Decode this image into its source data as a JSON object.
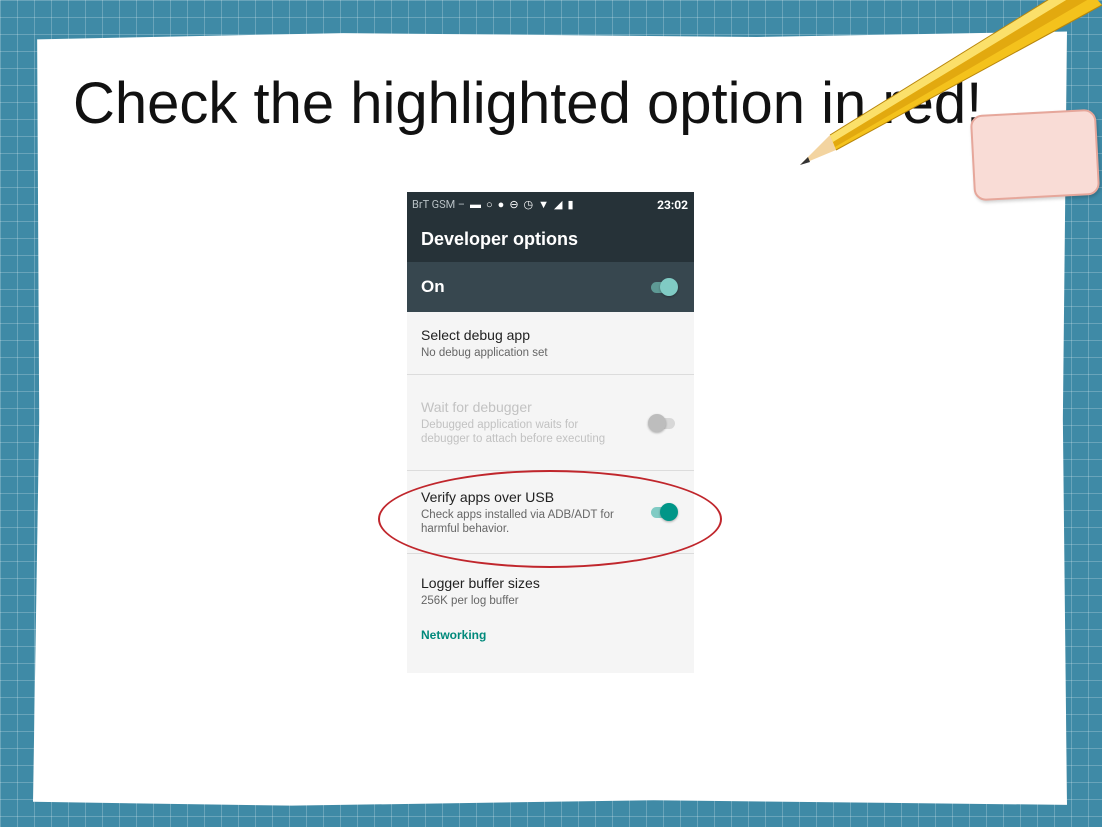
{
  "slide": {
    "title": "Check the highlighted option in red!"
  },
  "colors": {
    "highlight_ellipse": "#c0262c",
    "accent_teal": "#009688",
    "toolbar": "#263238",
    "master_switch_bar": "#37474f",
    "section_header": "#00897b",
    "background_grid": "#3f8aa6"
  },
  "status_bar": {
    "carrier": "BrT GSM — C",
    "icons": [
      "message-icon",
      "search-icon",
      "android-icon",
      "do-not-disturb-icon",
      "alarm-icon",
      "wifi-icon",
      "signal-icon",
      "battery-icon"
    ],
    "time": "23:02"
  },
  "app_bar": {
    "title": "Developer options"
  },
  "master_switch": {
    "label": "On",
    "state": "on"
  },
  "settings": [
    {
      "title": "Select debug app",
      "summary": "No debug application set",
      "enabled": true
    },
    {
      "title": "Wait for debugger",
      "summary": "Debugged application waits for debugger to attach before executing",
      "enabled": false,
      "toggle": "off"
    },
    {
      "title": "Verify apps over USB",
      "summary": "Check apps installed via ADB/ADT for harmful behavior.",
      "enabled": true,
      "toggle": "on",
      "highlighted": true
    },
    {
      "title": "Logger buffer sizes",
      "summary": "256K per log buffer",
      "enabled": true
    }
  ],
  "section_header": "Networking"
}
